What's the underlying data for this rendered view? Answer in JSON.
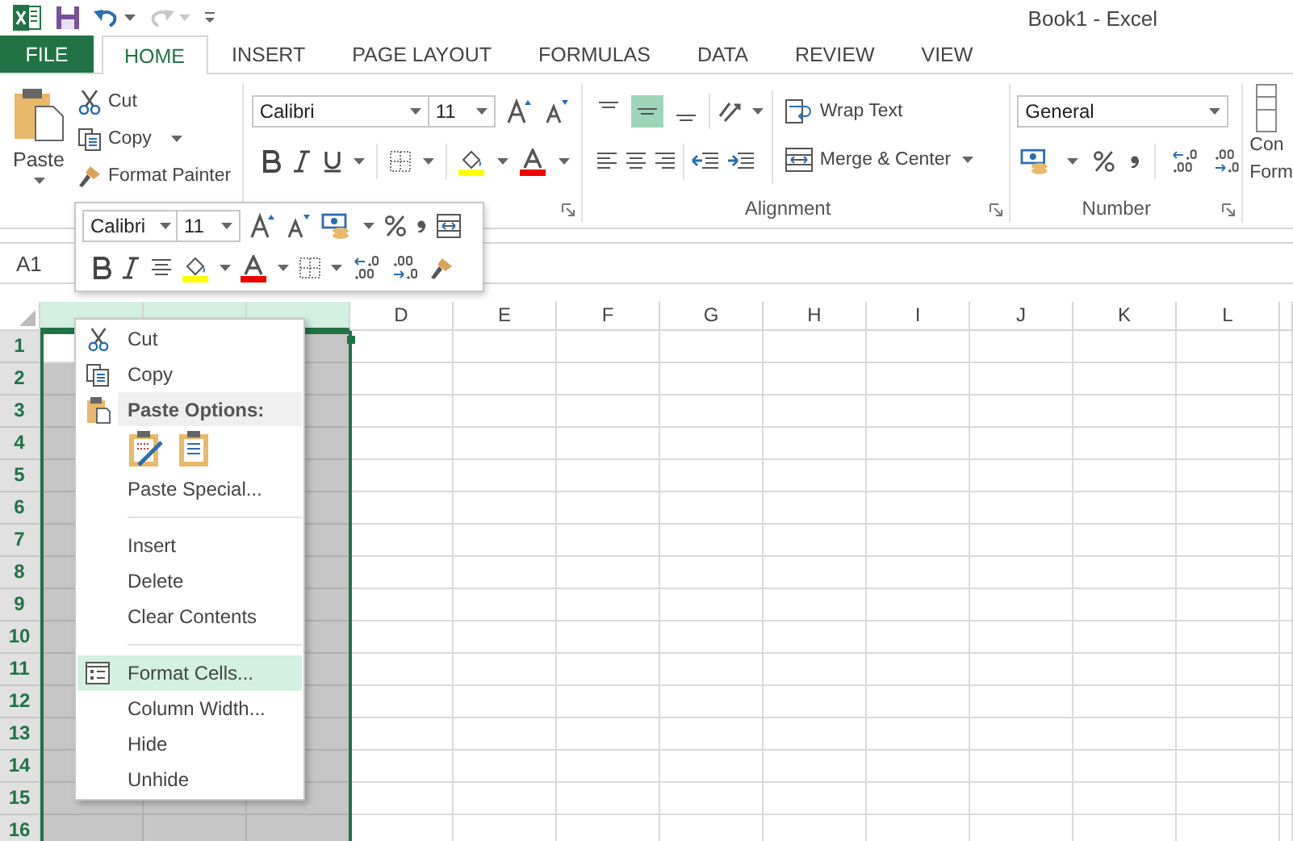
{
  "window": {
    "title": "Book1 - Excel"
  },
  "quick_access": {
    "redo": {
      "disabled": true
    }
  },
  "tabs": [
    {
      "label": "FILE",
      "kind": "file",
      "selected": false
    },
    {
      "label": "HOME",
      "kind": "tab",
      "selected": true
    },
    {
      "label": "INSERT",
      "kind": "tab",
      "selected": false
    },
    {
      "label": "PAGE LAYOUT",
      "kind": "tab",
      "selected": false
    },
    {
      "label": "FORMULAS",
      "kind": "tab",
      "selected": false
    },
    {
      "label": "DATA",
      "kind": "tab",
      "selected": false
    },
    {
      "label": "REVIEW",
      "kind": "tab",
      "selected": false
    },
    {
      "label": "VIEW",
      "kind": "tab",
      "selected": false
    }
  ],
  "ribbon": {
    "clipboard": {
      "paste": "Paste",
      "cut": "Cut",
      "copy": "Copy",
      "format_painter": "Format Painter"
    },
    "font": {
      "font_name": "Calibri",
      "font_size": "11"
    },
    "alignment": {
      "vertical_align": [
        {
          "selected": false
        },
        {
          "selected": true
        },
        {
          "selected": false
        }
      ],
      "wrap_text": "Wrap Text",
      "merge_center": "Merge & Center",
      "label": "Alignment"
    },
    "number": {
      "format": "General",
      "label": "Number"
    },
    "styles": {
      "conditional_formatting": [
        "Con",
        "Form"
      ]
    }
  },
  "mini_toolbar": {
    "font_name": "Calibri",
    "font_size": "11"
  },
  "formula_bar": {
    "name_box": "A1"
  },
  "sheet": {
    "columns": [
      {
        "selected": true
      },
      {
        "selected": true
      },
      {
        "selected": true
      },
      {
        "label": "D",
        "selected": false
      },
      {
        "label": "E",
        "selected": false
      },
      {
        "label": "F",
        "selected": false
      },
      {
        "label": "G",
        "selected": false
      },
      {
        "label": "H",
        "selected": false
      },
      {
        "label": "I",
        "selected": false
      },
      {
        "label": "J",
        "selected": false
      },
      {
        "label": "K",
        "selected": false
      },
      {
        "label": "L",
        "selected": false
      }
    ],
    "rows": [
      {
        "label": "1",
        "selected": true
      },
      {
        "label": "2",
        "selected": true
      },
      {
        "label": "3",
        "selected": true
      },
      {
        "label": "4",
        "selected": true
      },
      {
        "label": "5",
        "selected": true
      },
      {
        "label": "6",
        "selected": true
      },
      {
        "label": "7",
        "selected": true
      },
      {
        "label": "8",
        "selected": true
      },
      {
        "label": "9",
        "selected": true
      },
      {
        "label": "10",
        "selected": true
      },
      {
        "label": "11",
        "selected": true
      },
      {
        "label": "12",
        "selected": true
      },
      {
        "label": "13",
        "selected": true
      },
      {
        "label": "14",
        "selected": true
      },
      {
        "label": "15",
        "selected": true
      },
      {
        "label": "16",
        "selected": true
      }
    ]
  },
  "context_menu": {
    "items": [
      {
        "kind": "command",
        "label": "Cut",
        "selected": false
      },
      {
        "kind": "command",
        "label": "Copy",
        "selected": false
      },
      {
        "kind": "header",
        "label": "Paste Options:"
      },
      {
        "kind": "paste_buttons"
      },
      {
        "kind": "command",
        "label": "Paste Special...",
        "selected": false
      },
      {
        "kind": "separator"
      },
      {
        "kind": "command",
        "label": "Insert",
        "selected": false
      },
      {
        "kind": "command",
        "label": "Delete",
        "selected": false
      },
      {
        "kind": "command",
        "label": "Clear Contents",
        "selected": false
      },
      {
        "kind": "separator"
      },
      {
        "kind": "command",
        "label": "Format Cells...",
        "selected": true
      },
      {
        "kind": "command",
        "label": "Column Width...",
        "selected": false
      },
      {
        "kind": "command",
        "label": "Hide",
        "selected": false
      },
      {
        "kind": "command",
        "label": "Unhide",
        "selected": false
      }
    ]
  }
}
